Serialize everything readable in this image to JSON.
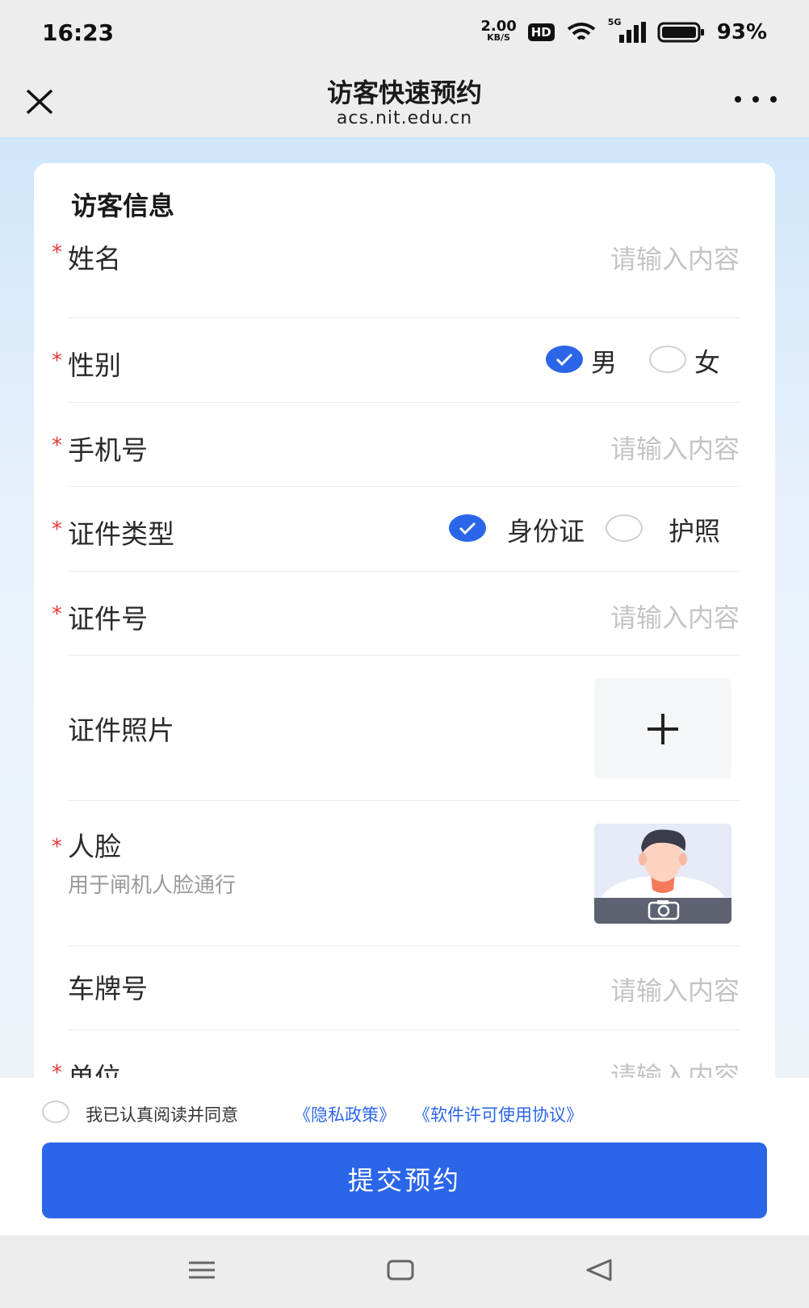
{
  "status_bar": {
    "time": "16:23",
    "speed_value": "2.00",
    "speed_unit": "KB/S",
    "hd": "HD",
    "network": "5G",
    "battery": "93%"
  },
  "nav": {
    "title": "访客快速预约",
    "subtitle": "acs.nit.edu.cn"
  },
  "form": {
    "section_title": "访客信息",
    "name": {
      "label": "姓名",
      "placeholder": "请输入内容"
    },
    "gender": {
      "label": "性别",
      "options": [
        "男",
        "女"
      ],
      "selected": "男"
    },
    "phone": {
      "label": "手机号",
      "placeholder": "请输入内容"
    },
    "id_type": {
      "label": "证件类型",
      "options": [
        "身份证",
        "护照"
      ],
      "selected": "身份证"
    },
    "id_number": {
      "label": "证件号",
      "placeholder": "请输入内容"
    },
    "id_photo": {
      "label": "证件照片"
    },
    "face": {
      "label": "人脸",
      "hint": "用于闸机人脸通行"
    },
    "plate": {
      "label": "车牌号",
      "placeholder": "请输入内容"
    },
    "unit": {
      "label": "单位",
      "placeholder": "请输入内容"
    }
  },
  "footer": {
    "agree_text": "我已认真阅读并同意",
    "privacy_link": "《隐私政策》",
    "license_link": "《软件许可使用协议》",
    "submit_label": "提交预约"
  },
  "colors": {
    "accent": "#2b66e8",
    "required": "#e53935"
  }
}
